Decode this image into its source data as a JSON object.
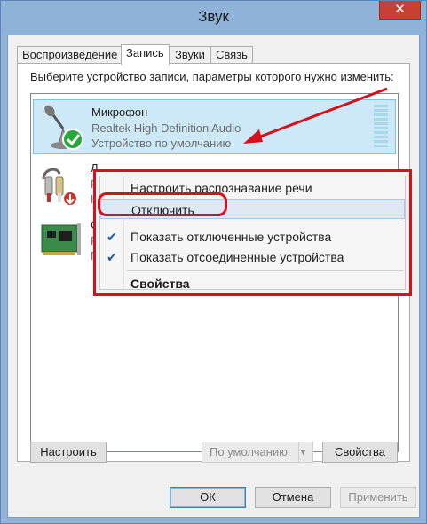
{
  "window": {
    "title": "Звук",
    "close_glyph": "✕"
  },
  "tabs": [
    {
      "label": "Воспроизведение"
    },
    {
      "label": "Запись",
      "active": true
    },
    {
      "label": "Звуки"
    },
    {
      "label": "Связь"
    }
  ],
  "instruction": "Выберите устройство записи, параметры которого нужно изменить:",
  "devices": [
    {
      "name": "Микрофон",
      "line1": "Realtek High Definition Audio",
      "line2": "Устройство по умолчанию",
      "icon": "microphone-icon",
      "status": "default-checkmark",
      "selected": true
    },
    {
      "name": "Л",
      "line1": "R",
      "line2": "Н",
      "icon": "line-in-icon",
      "status": "disconnected-arrow"
    },
    {
      "name": "С",
      "line1": "R",
      "line2": "Г",
      "icon": "sound-card-icon"
    }
  ],
  "context_menu": {
    "items": [
      {
        "label": "Настроить распознавание речи",
        "checked": false
      },
      {
        "label": "Отключить",
        "checked": false,
        "highlighted": true
      },
      {
        "label": "Показать отключенные устройства",
        "checked": true
      },
      {
        "label": "Показать отсоединенные устройства",
        "checked": true
      },
      {
        "label": "Свойства",
        "bold": true
      }
    ],
    "check_glyph": "✔"
  },
  "buttons": {
    "configure": "Настроить",
    "default": "По умолчанию",
    "properties": "Свойства",
    "ok": "ОК",
    "cancel": "Отмена",
    "apply": "Применить"
  },
  "colors": {
    "accent": "#d7101c",
    "selection": "#cde8f7",
    "titlebar": "#8fb2d8",
    "close": "#c84031"
  }
}
